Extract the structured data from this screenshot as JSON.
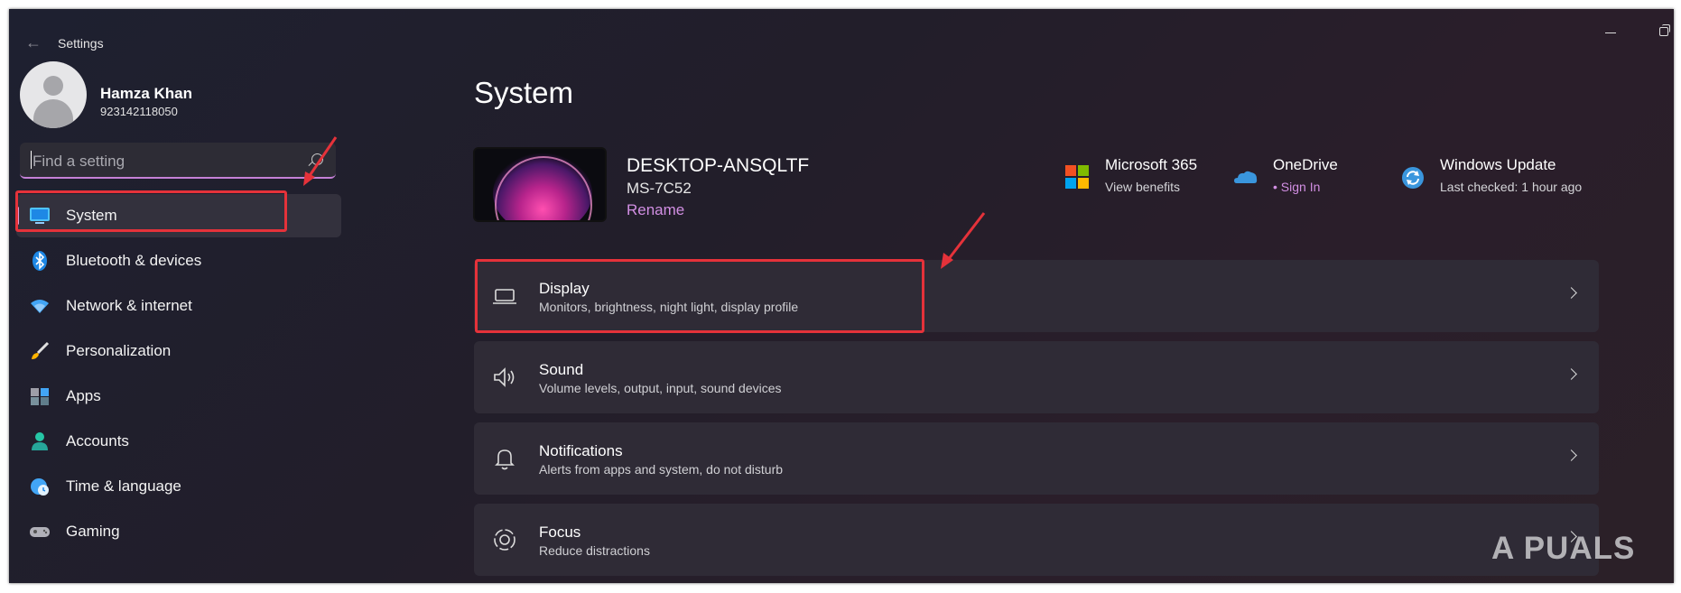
{
  "window": {
    "title": "Settings"
  },
  "user": {
    "name": "Hamza Khan",
    "id": "923142118050"
  },
  "search": {
    "placeholder": "Find a setting"
  },
  "sidebar": {
    "items": [
      {
        "label": "System",
        "icon": "monitor-icon",
        "selected": true
      },
      {
        "label": "Bluetooth & devices",
        "icon": "bluetooth-icon"
      },
      {
        "label": "Network & internet",
        "icon": "wifi-icon"
      },
      {
        "label": "Personalization",
        "icon": "brush-icon"
      },
      {
        "label": "Apps",
        "icon": "apps-icon"
      },
      {
        "label": "Accounts",
        "icon": "person-icon"
      },
      {
        "label": "Time & language",
        "icon": "globe-clock-icon"
      },
      {
        "label": "Gaming",
        "icon": "gamepad-icon"
      }
    ]
  },
  "main": {
    "title": "System",
    "device": {
      "name": "DESKTOP-ANSQLTF",
      "model": "MS-7C52",
      "rename": "Rename"
    },
    "quick_links": [
      {
        "title": "Microsoft 365",
        "subtitle": "View benefits",
        "icon": "microsoft-logo-icon"
      },
      {
        "title": "OneDrive",
        "subtitle": "• Sign In",
        "icon": "onedrive-cloud-icon"
      },
      {
        "title": "Windows Update",
        "subtitle": "Last checked: 1 hour ago",
        "icon": "windows-update-icon"
      }
    ],
    "cards": [
      {
        "title": "Display",
        "subtitle": "Monitors, brightness, night light, display profile",
        "icon": "laptop-icon"
      },
      {
        "title": "Sound",
        "subtitle": "Volume levels, output, input, sound devices",
        "icon": "speaker-icon"
      },
      {
        "title": "Notifications",
        "subtitle": "Alerts from apps and system, do not disturb",
        "icon": "bell-icon"
      },
      {
        "title": "Focus",
        "subtitle": "Reduce distractions",
        "icon": "focus-icon"
      }
    ]
  },
  "watermark": "A PUALS",
  "colors": {
    "accent": "#e29bd2",
    "annotation_red": "#e5323a",
    "link": "#d28fe3"
  }
}
